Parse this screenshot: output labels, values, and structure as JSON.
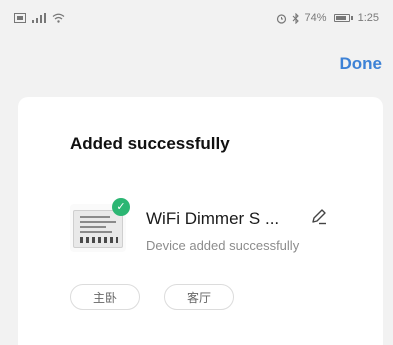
{
  "status_bar": {
    "battery": "74%",
    "time": "1:25"
  },
  "header": {
    "done_label": "Done"
  },
  "card": {
    "title": "Added successfully",
    "device": {
      "name": "WiFi Dimmer S ...",
      "status": "Device added successfully"
    },
    "rooms": [
      "主卧",
      "客厅"
    ]
  },
  "colors": {
    "accent": "#3d82d6",
    "success": "#2cb673",
    "background": "#f2f2f2"
  }
}
